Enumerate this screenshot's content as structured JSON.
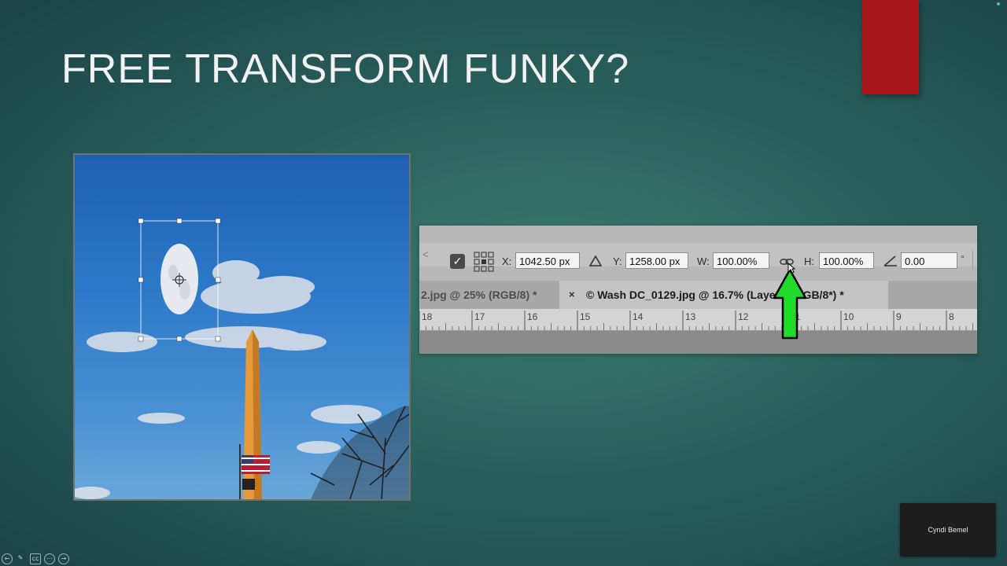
{
  "slide": {
    "title": "FREE TRANSFORM FUNKY?",
    "presenter_name": "Cyndi Bemel",
    "accent_red": "#a8171b",
    "arrow_green": "#1fdc2b"
  },
  "photoshop": {
    "options": {
      "x_label": "X:",
      "x_value": "1042.50 px",
      "y_label": "Y:",
      "y_value": "1258.00 px",
      "w_label": "W:",
      "w_value": "100.00%",
      "h_label": "H:",
      "h_value": "100.00%",
      "angle_value": "0.00",
      "degree_symbol": "°",
      "checkbox_checked": true
    },
    "tabs": {
      "inactive_label": "2.jpg @ 25% (RGB/8) *",
      "close_glyph": "×",
      "active_label": "© Wash DC_0129.jpg @ 16.7% (Layer 1, RGB/8*) *"
    },
    "ruler_ticks": [
      "18",
      "17",
      "16",
      "15",
      "14",
      "13",
      "12",
      "11",
      "10",
      "9",
      "8"
    ]
  },
  "icons": {
    "checkbox": "checkmark-icon",
    "reference_point": "reference-point-grid-icon",
    "delta": "delta-triangle-icon",
    "link": "chain-link-icon",
    "angle": "angle-icon"
  }
}
